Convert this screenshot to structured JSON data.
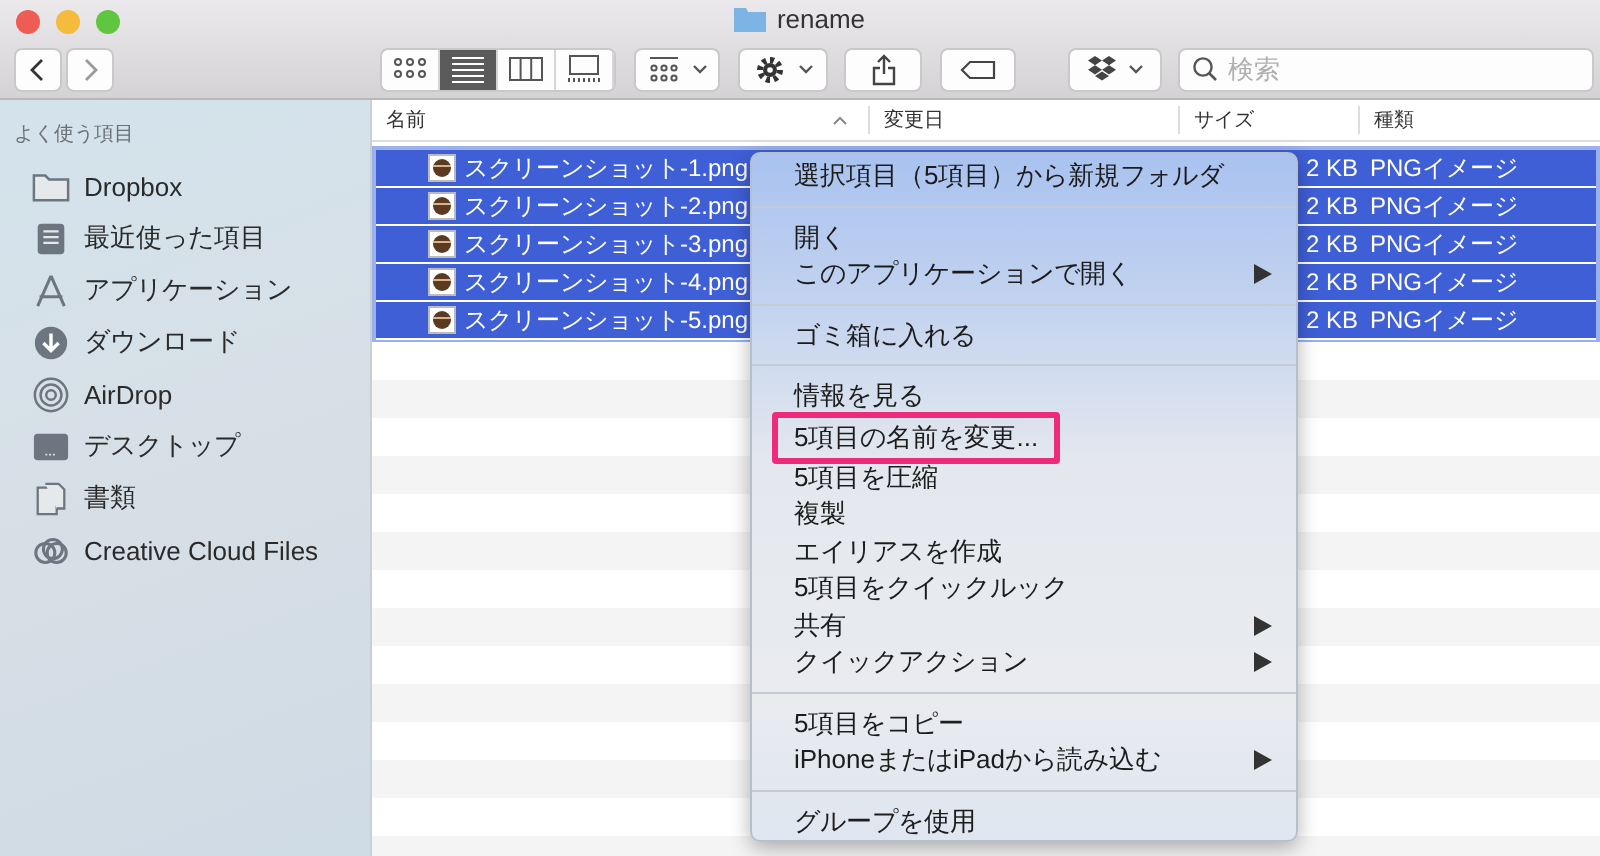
{
  "window": {
    "title": "rename"
  },
  "toolbar": {
    "views": [
      {
        "kind": "icons",
        "selected": false
      },
      {
        "kind": "list",
        "selected": true
      },
      {
        "kind": "columns",
        "selected": false
      },
      {
        "kind": "gallery",
        "selected": false
      }
    ],
    "search": {
      "placeholder": "検索"
    }
  },
  "sidebar": {
    "heading": "よく使う項目",
    "items": [
      {
        "kind": "folder",
        "label": "Dropbox"
      },
      {
        "kind": "recent",
        "label": "最近使った項目"
      },
      {
        "kind": "apps",
        "label": "アプリケーション"
      },
      {
        "kind": "download",
        "label": "ダウンロード"
      },
      {
        "kind": "airdrop",
        "label": "AirDrop"
      },
      {
        "kind": "desktop",
        "label": "デスクトップ"
      },
      {
        "kind": "documents",
        "label": "書類"
      },
      {
        "kind": "cloud",
        "label": "Creative Cloud Files"
      }
    ]
  },
  "table": {
    "columns": [
      "名前",
      "変更日",
      "サイズ",
      "種類"
    ],
    "rows": [
      {
        "name": "スクリーンショット-1.png",
        "size": "2 KB",
        "kind": "PNGイメージ",
        "selected": true
      },
      {
        "name": "スクリーンショット-2.png",
        "size": "2 KB",
        "kind": "PNGイメージ",
        "selected": true
      },
      {
        "name": "スクリーンショット-3.png",
        "size": "2 KB",
        "kind": "PNGイメージ",
        "selected": true
      },
      {
        "name": "スクリーンショット-4.png",
        "size": "2 KB",
        "kind": "PNGイメージ",
        "selected": true
      },
      {
        "name": "スクリーンショット-5.png",
        "size": "2 KB",
        "kind": "PNGイメージ",
        "selected": true
      }
    ]
  },
  "context_menu": {
    "items": [
      {
        "kind": "item",
        "label": "選択項目（5項目）から新規フォルダ",
        "submenu": false,
        "annotated": false
      },
      {
        "kind": "separator"
      },
      {
        "kind": "item",
        "label": "開く",
        "submenu": false,
        "annotated": false
      },
      {
        "kind": "item",
        "label": "このアプリケーションで開く",
        "submenu": true,
        "annotated": false
      },
      {
        "kind": "separator"
      },
      {
        "kind": "item",
        "label": "ゴミ箱に入れる",
        "submenu": false,
        "annotated": false
      },
      {
        "kind": "separator"
      },
      {
        "kind": "item",
        "label": "情報を見る",
        "submenu": false,
        "annotated": false
      },
      {
        "kind": "item",
        "label": "5項目の名前を変更...",
        "submenu": false,
        "annotated": true
      },
      {
        "kind": "item",
        "label": "5項目を圧縮",
        "submenu": false,
        "annotated": false
      },
      {
        "kind": "item",
        "label": "複製",
        "submenu": false,
        "annotated": false
      },
      {
        "kind": "item",
        "label": "エイリアスを作成",
        "submenu": false,
        "annotated": false
      },
      {
        "kind": "item",
        "label": "5項目をクイックルック",
        "submenu": false,
        "annotated": false
      },
      {
        "kind": "item",
        "label": "共有",
        "submenu": true,
        "annotated": false
      },
      {
        "kind": "item",
        "label": "クイックアクション",
        "submenu": true,
        "annotated": false
      },
      {
        "kind": "separator"
      },
      {
        "kind": "item",
        "label": "5項目をコピー",
        "submenu": false,
        "annotated": false
      },
      {
        "kind": "item",
        "label": "iPhoneまたはiPadから読み込む",
        "submenu": true,
        "annotated": false
      },
      {
        "kind": "separator"
      },
      {
        "kind": "item",
        "label": "グループを使用",
        "submenu": false,
        "annotated": false
      }
    ]
  }
}
